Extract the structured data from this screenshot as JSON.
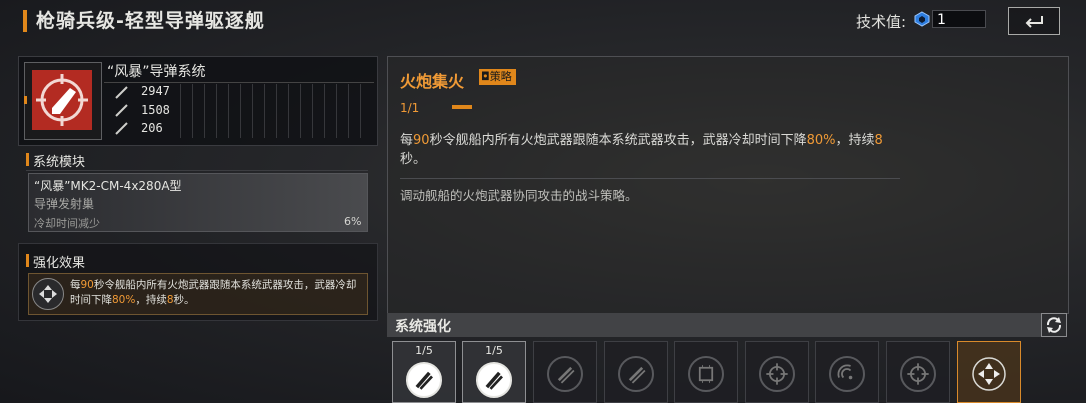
{
  "header": {
    "title": "枪骑兵级-轻型导弹驱逐舰",
    "tech_label": "技术值:",
    "tech_value": "1"
  },
  "weapon": {
    "name": "“风暴”导弹系统",
    "stats": [
      "2947",
      "1508",
      "206"
    ]
  },
  "system_module": {
    "heading": "系统模块",
    "name": "“风暴”MK2-CM-4x280A型",
    "type": "导弹发射巢",
    "stat_label": "冷却时间减少",
    "stat_value": "6%"
  },
  "enhancement_effect": {
    "heading": "强化效果",
    "text_parts": [
      "每",
      "90",
      "秒令舰船内所有火炮武器跟随本系统武器攻击，武器冷却时间下降",
      "80%",
      "，持续",
      "8",
      "秒。"
    ]
  },
  "skill": {
    "title": "火炮集火",
    "tag": "策略",
    "progress": "1/1",
    "desc_parts": [
      "每",
      "90",
      "秒令舰船内所有火炮武器跟随本系统武器攻击，武器冷却时间下降",
      "80%",
      "，持续",
      "8",
      "秒。"
    ],
    "flavor": "调动舰船的火炮武器协同攻击的战斗策略。"
  },
  "system_enhance": {
    "title": "系统强化",
    "slots": [
      {
        "label": "1/5",
        "icon": "missile-icon",
        "state": "active"
      },
      {
        "label": "1/5",
        "icon": "missile-icon",
        "state": "active"
      },
      {
        "label": "",
        "icon": "missile-icon",
        "state": "locked"
      },
      {
        "label": "",
        "icon": "missile-icon",
        "state": "locked"
      },
      {
        "label": "",
        "icon": "chip-icon",
        "state": "locked"
      },
      {
        "label": "",
        "icon": "target-icon",
        "state": "locked"
      },
      {
        "label": "",
        "icon": "radar-icon",
        "state": "locked"
      },
      {
        "label": "",
        "icon": "target-icon",
        "state": "locked"
      },
      {
        "label": "",
        "icon": "strategy-icon",
        "state": "selected"
      }
    ]
  },
  "colors": {
    "accent": "#e0871b",
    "weapon_icon_bg": "#b32b22"
  }
}
